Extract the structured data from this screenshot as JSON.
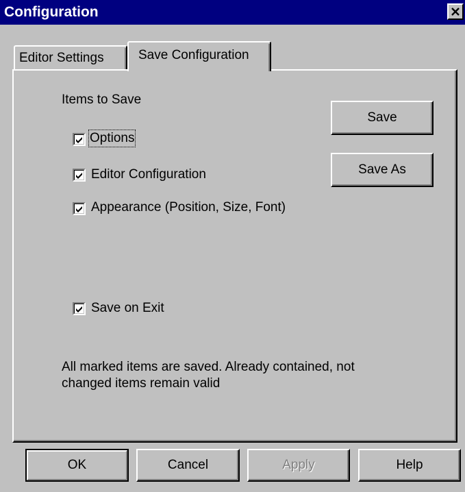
{
  "window": {
    "title": "Configuration"
  },
  "tabs": [
    {
      "label": "Editor Settings"
    },
    {
      "label": "Save Configuration"
    }
  ],
  "save_tab": {
    "group_label": "Items to Save",
    "items": [
      {
        "label": "Options",
        "checked": true
      },
      {
        "label": "Editor Configuration",
        "checked": true
      },
      {
        "label": "Appearance (Position, Size, Font)",
        "checked": true
      }
    ],
    "save_on_exit": {
      "label": "Save on Exit",
      "checked": true
    },
    "save_button": "Save",
    "save_as_button": "Save As",
    "note_line1": "All marked items are saved. Already contained, not",
    "note_line2": "changed items remain valid"
  },
  "footer": {
    "ok": "OK",
    "cancel": "Cancel",
    "apply": "Apply",
    "help": "Help"
  }
}
